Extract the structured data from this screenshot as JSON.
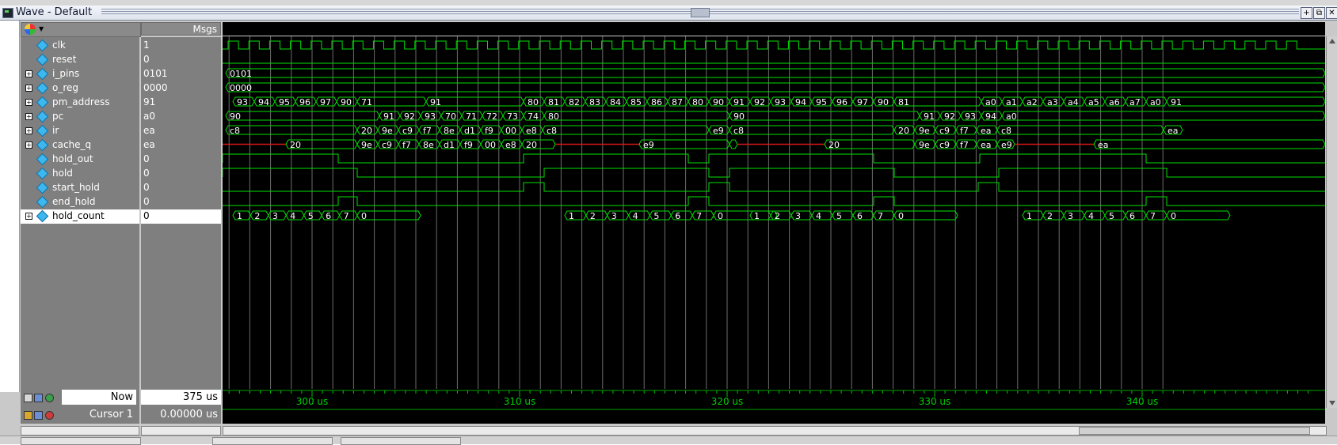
{
  "window": {
    "title": "Wave - Default"
  },
  "headers": {
    "values_col": "Msgs"
  },
  "colors": {
    "wave": "#00e000",
    "undefined": "#d81818",
    "text": "#ffffff",
    "cursor_lines": "#6c6c6c",
    "timeline_text": "#00d000"
  },
  "signals": [
    {
      "name": "clk",
      "value": "1",
      "expandable": false
    },
    {
      "name": "reset",
      "value": "0",
      "expandable": false
    },
    {
      "name": "i_pins",
      "value": "0101",
      "expandable": true
    },
    {
      "name": "o_reg",
      "value": "0000",
      "expandable": true
    },
    {
      "name": "pm_address",
      "value": "91",
      "expandable": true
    },
    {
      "name": "pc",
      "value": "a0",
      "expandable": true
    },
    {
      "name": "ir",
      "value": "ea",
      "expandable": true
    },
    {
      "name": "cache_q",
      "value": "ea",
      "expandable": true
    },
    {
      "name": "hold_out",
      "value": "0",
      "expandable": false
    },
    {
      "name": "hold",
      "value": "0",
      "expandable": false
    },
    {
      "name": "start_hold",
      "value": "0",
      "expandable": false
    },
    {
      "name": "end_hold",
      "value": "0",
      "expandable": false
    },
    {
      "name": "hold_count",
      "value": "0",
      "expandable": true,
      "selected": true
    }
  ],
  "status": {
    "now_label": "Now",
    "now_value": "375 us",
    "cursor_label": "Cursor 1",
    "cursor_value": "0.00000 us"
  },
  "timeline": {
    "labels": [
      "300 us",
      "310 us",
      "320 us",
      "330 us",
      "340 us"
    ],
    "positions_us": [
      300,
      310,
      320,
      330,
      340
    ]
  },
  "waves": {
    "clk_count": 50,
    "bus": {
      "i_pins": [
        [
          "0101",
          false
        ]
      ],
      "o_reg": [
        [
          "0000",
          false
        ]
      ],
      "pm_address": [
        [
          "93",
          false
        ],
        [
          "94",
          false
        ],
        [
          "95",
          false
        ],
        [
          "96",
          false
        ],
        [
          "97",
          false
        ],
        [
          "90",
          false
        ],
        [
          "71",
          false
        ],
        [
          "91",
          false
        ],
        [
          "80",
          false
        ],
        [
          "81",
          false
        ],
        [
          "82",
          false
        ],
        [
          "83",
          false
        ],
        [
          "84",
          false
        ],
        [
          "85",
          false
        ],
        [
          "86",
          false
        ],
        [
          "87",
          false
        ],
        [
          "80",
          false
        ],
        [
          "90",
          false
        ],
        [
          "91",
          false
        ],
        [
          "92",
          false
        ],
        [
          "93",
          false
        ],
        [
          "94",
          false
        ],
        [
          "95",
          false
        ],
        [
          "96",
          false
        ],
        [
          "97",
          false
        ],
        [
          "90",
          false
        ],
        [
          "81",
          false
        ],
        [
          "a0",
          false
        ],
        [
          "a1",
          false
        ],
        [
          "a2",
          false
        ],
        [
          "a3",
          false
        ],
        [
          "a4",
          false
        ],
        [
          "a5",
          false
        ],
        [
          "a6",
          false
        ],
        [
          "a7",
          false
        ],
        [
          "a0",
          false
        ],
        [
          "91",
          false
        ]
      ],
      "pc": [
        [
          "90",
          false
        ],
        [
          "91",
          false
        ],
        [
          "92",
          false
        ],
        [
          "93",
          false
        ],
        [
          "70",
          false
        ],
        [
          "71",
          false
        ],
        [
          "72",
          false
        ],
        [
          "73",
          false
        ],
        [
          "74",
          false
        ],
        [
          "80",
          false
        ],
        [
          "90",
          false
        ],
        [
          "91",
          false
        ],
        [
          "92",
          false
        ],
        [
          "93",
          false
        ],
        [
          "94",
          false
        ],
        [
          "a0",
          false
        ]
      ],
      "ir": [
        [
          "c8",
          false
        ],
        [
          "20",
          false
        ],
        [
          "9e",
          false
        ],
        [
          "c9",
          false
        ],
        [
          "f7",
          false
        ],
        [
          "8e",
          false
        ],
        [
          "d1",
          false
        ],
        [
          "f9",
          false
        ],
        [
          "00",
          false
        ],
        [
          "e8",
          false
        ],
        [
          "c8",
          false
        ],
        [
          "e9",
          false
        ],
        [
          "c8",
          false
        ],
        [
          "20",
          false
        ],
        [
          "9e",
          false
        ],
        [
          "c9",
          false
        ],
        [
          "f7",
          false
        ],
        [
          "ea",
          false
        ],
        [
          "c8",
          false
        ],
        [
          "ea",
          false
        ]
      ],
      "cache_q": [
        [
          "",
          true
        ],
        [
          "20",
          false
        ],
        [
          "9e",
          false
        ],
        [
          "c9",
          false
        ],
        [
          "f7",
          false
        ],
        [
          "8e",
          false
        ],
        [
          "d1",
          false
        ],
        [
          "f9",
          false
        ],
        [
          "00",
          false
        ],
        [
          "e8",
          false
        ],
        [
          "20",
          false
        ],
        [
          "",
          true
        ],
        [
          "e9",
          false
        ],
        [
          "",
          false
        ],
        [
          "",
          true
        ],
        [
          "20",
          false
        ],
        [
          "9e",
          false
        ],
        [
          "c9",
          false
        ],
        [
          "f7",
          false
        ],
        [
          "ea",
          false
        ],
        [
          "e9",
          false
        ],
        [
          "",
          true
        ],
        [
          "ea",
          false
        ]
      ],
      "hold_count": [
        [
          "1",
          false
        ],
        [
          "2",
          false
        ],
        [
          "3",
          false
        ],
        [
          "4",
          false
        ],
        [
          "5",
          false
        ],
        [
          "6",
          false
        ],
        [
          "7",
          false
        ],
        [
          "0",
          false
        ],
        [
          "1",
          false
        ],
        [
          "2",
          false
        ],
        [
          "3",
          false
        ],
        [
          "4",
          false
        ],
        [
          "5",
          false
        ],
        [
          "6",
          false
        ],
        [
          "7",
          false
        ],
        [
          "0",
          false
        ],
        [
          "1",
          false
        ],
        [
          "2",
          false
        ],
        [
          "3",
          false
        ],
        [
          "4",
          false
        ],
        [
          "5",
          false
        ],
        [
          "6",
          false
        ],
        [
          "7",
          false
        ],
        [
          "0",
          false
        ],
        [
          "1",
          false
        ],
        [
          "2",
          false
        ],
        [
          "3",
          false
        ],
        [
          "4",
          false
        ],
        [
          "5",
          false
        ],
        [
          "6",
          false
        ],
        [
          "7",
          false
        ],
        [
          "0",
          false
        ]
      ]
    }
  }
}
